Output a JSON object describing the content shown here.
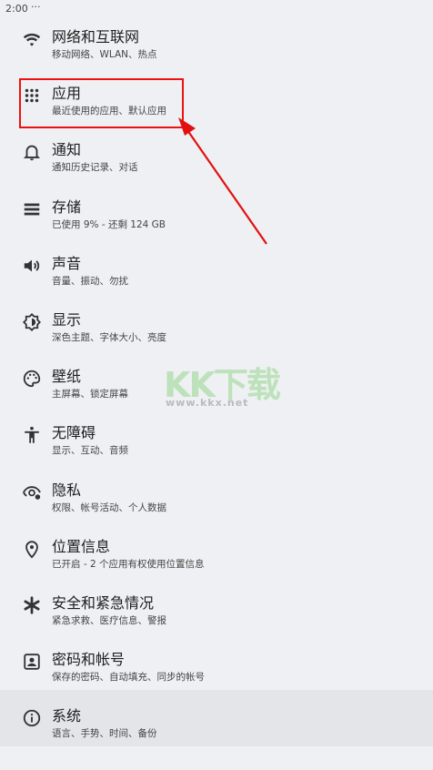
{
  "status_bar": {
    "time": "2:00",
    "more": "···"
  },
  "settings": [
    {
      "title": "网络和互联网",
      "summary": "移动网络、WLAN、热点",
      "icon": "wifi-icon"
    },
    {
      "title": "应用",
      "summary": "最近使用的应用、默认应用",
      "icon": "apps-grid-icon"
    },
    {
      "title": "通知",
      "summary": "通知历史记录、对话",
      "icon": "bell-icon"
    },
    {
      "title": "存储",
      "summary": "已使用 9% - 还剩 124 GB",
      "icon": "storage-icon"
    },
    {
      "title": "声音",
      "summary": "音量、振动、勿扰",
      "icon": "volume-icon"
    },
    {
      "title": "显示",
      "summary": "深色主题、字体大小、亮度",
      "icon": "brightness-icon"
    },
    {
      "title": "壁纸",
      "summary": "主屏幕、锁定屏幕",
      "icon": "palette-icon"
    },
    {
      "title": "无障碍",
      "summary": "显示、互动、音频",
      "icon": "accessibility-icon"
    },
    {
      "title": "隐私",
      "summary": "权限、帐号活动、个人数据",
      "icon": "eye-icon"
    },
    {
      "title": "位置信息",
      "summary": "已开启 - 2 个应用有权使用位置信息",
      "icon": "location-pin-icon"
    },
    {
      "title": "安全和紧急情况",
      "summary": "紧急求救、医疗信息、警报",
      "icon": "asterisk-icon"
    },
    {
      "title": "密码和帐号",
      "summary": "保存的密码、自动填充、同步的帐号",
      "icon": "account-box-icon"
    },
    {
      "title": "系统",
      "summary": "语言、手势、时间、备份",
      "icon": "info-icon"
    }
  ],
  "watermark": {
    "logo": "KK下载",
    "url": "www.kkx.net"
  },
  "colors": {
    "annotation": "#e11111",
    "background": "#eef0f3",
    "selected_row": "#e3e5e8"
  }
}
